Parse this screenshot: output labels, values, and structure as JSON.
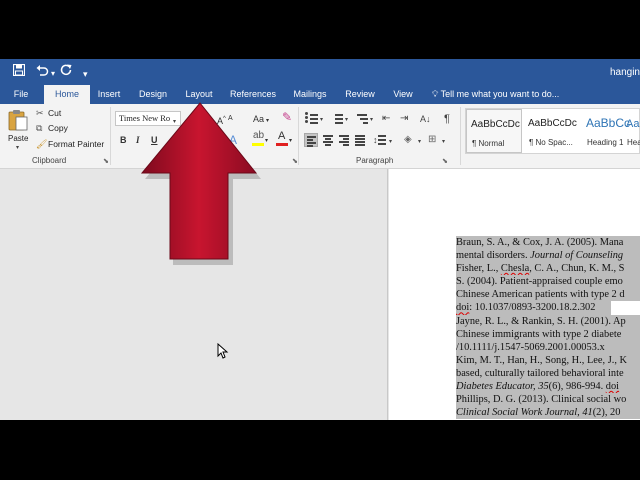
{
  "window": {
    "title": "hangin"
  },
  "quick_access": {
    "save_icon": "save-icon",
    "undo_icon": "undo-icon",
    "redo_icon": "redo-icon",
    "customize_icon": "customize-qat-icon"
  },
  "tabs": [
    {
      "label": "File"
    },
    {
      "label": "Home"
    },
    {
      "label": "Insert"
    },
    {
      "label": "Design"
    },
    {
      "label": "Layout"
    },
    {
      "label": "References"
    },
    {
      "label": "Mailings"
    },
    {
      "label": "Review"
    },
    {
      "label": "View"
    }
  ],
  "active_tab": "Home",
  "tell_me": {
    "placeholder": "Tell me what you want to do..."
  },
  "clipboard": {
    "paste_label": "Paste",
    "cut_label": "Cut",
    "copy_label": "Copy",
    "format_painter_label": "Format Painter",
    "group_label": "Clipboard"
  },
  "font": {
    "family_value": "Times New Ro",
    "bold": "B",
    "italic": "I",
    "underline": "U",
    "change_case": "Aa",
    "grow": "A",
    "shrink": "A",
    "font_color": "A",
    "highlight_color": "#ffff00",
    "text_color": "#e02020"
  },
  "paragraph": {
    "group_label": "Paragraph",
    "pilcrow": "¶"
  },
  "styles": [
    {
      "sample": "AaBbCcDc",
      "name": "¶ Normal"
    },
    {
      "sample": "AaBbCcDc",
      "name": "¶ No Spac..."
    },
    {
      "sample": "AaBbCc",
      "name": "Heading 1"
    },
    {
      "sample": "AaB",
      "name": "Hea"
    }
  ],
  "document": {
    "references": [
      {
        "a": "Braun, S. A., & Cox, J. A. (2005). Mana"
      },
      {
        "a": "mental disorders. ",
        "i": "Journal of Counseling"
      },
      {
        "a": "Fisher, L., ",
        "s": "Chesla",
        "b": ", C. A., Chun, K. M., S"
      },
      {
        "a": "S. (2004). Patient-appraised couple emo"
      },
      {
        "a": "Chinese American patients with type 2 d"
      },
      {
        "s": "doi",
        "a": ": 10.1037/0893-3200.18.2.302"
      },
      {
        "a": "Jayne, R. L., & Rankin, S. H. (2001). Ap"
      },
      {
        "a": "Chinese immigrants with type 2 diabete"
      },
      {
        "a": "/10.1111/j.1547-5069.2001.00053.x"
      },
      {
        "a": "Kim, M. T., Han, H., Song, H., Lee, J., K"
      },
      {
        "a": "based, culturally tailored behavioral inte"
      },
      {
        "i": "Diabetes Educator, 35",
        "a": "(6), 986-994. ",
        "s": "doi"
      },
      {
        "a": "Phillips, D. G. (2013). Clinical social wo"
      },
      {
        "i": "Clinical Social Work Journal, 41",
        "a": "(2), 20"
      }
    ]
  },
  "colors": {
    "ribbon_blue": "#2b579a",
    "arrow_red": "#b5122c",
    "selection_gray": "#bcbcbc"
  }
}
